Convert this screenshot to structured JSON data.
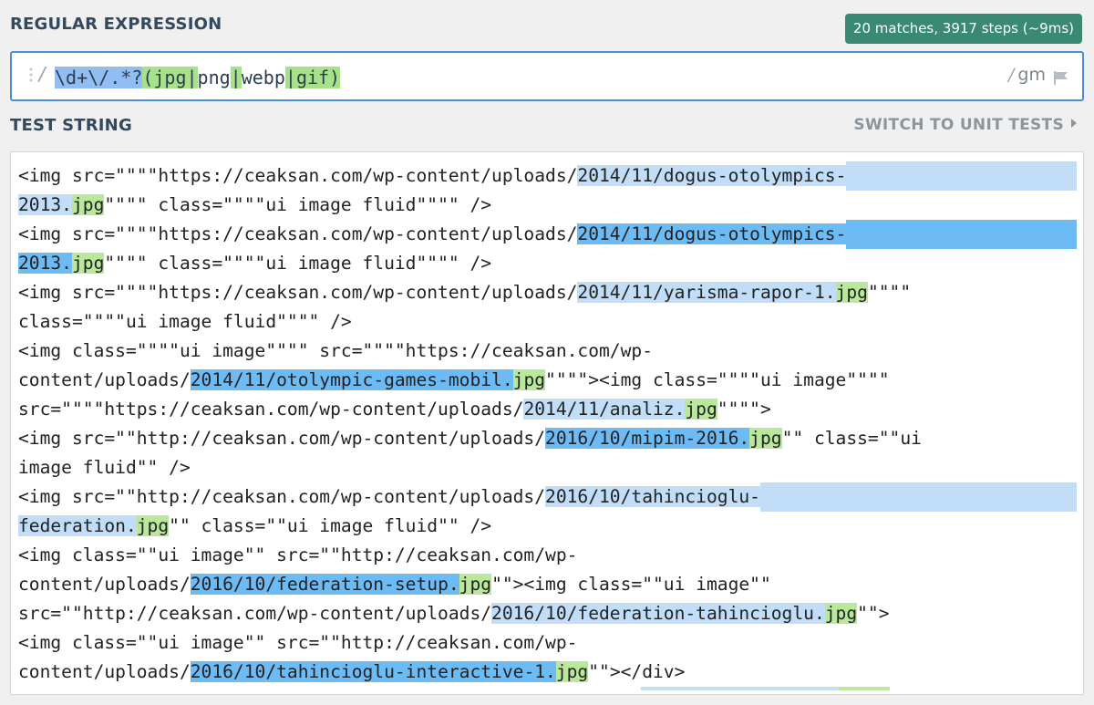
{
  "regex_section": {
    "label": "REGULAR EXPRESSION",
    "match_info": "20 matches, 3917 steps (~9ms)",
    "open_slash": "/",
    "close_slash": "/",
    "flags": "gm",
    "tokens": [
      {
        "text": "\\d+\\/.*?",
        "style": "blue"
      },
      {
        "text": "(jpg",
        "style": "green-paren"
      },
      {
        "text": "|",
        "style": "green"
      },
      {
        "text": "png",
        "style": "plain"
      },
      {
        "text": "|",
        "style": "green"
      },
      {
        "text": "webp",
        "style": "plain"
      },
      {
        "text": "|",
        "style": "green"
      },
      {
        "text": "gif)",
        "style": "green-paren"
      }
    ]
  },
  "test_section": {
    "label": "TEST STRING",
    "switch_label": "SWITCH TO UNIT TESTS",
    "lines": [
      [
        {
          "t": "<img src=\"\"\"\"https://ceaksan.com/wp-content/uploads/"
        },
        {
          "t": "2014/11/dogus-otolympics-",
          "c": "m-light"
        },
        {
          "t": "",
          "c": "m-light",
          "fill": true
        }
      ],
      [
        {
          "t": "2013.",
          "c": "m-light"
        },
        {
          "t": "jpg",
          "c": "g"
        },
        {
          "t": "\"\"\"\" class=\"\"\"\"ui image fluid\"\"\"\" />"
        }
      ],
      [
        {
          "t": "<img src=\"\"\"\"https://ceaksan.com/wp-content/uploads/"
        },
        {
          "t": "2014/11/dogus-otolympics-",
          "c": "m-dark"
        },
        {
          "t": "",
          "c": "m-dark",
          "fill": true
        }
      ],
      [
        {
          "t": "2013.",
          "c": "m-dark"
        },
        {
          "t": "jpg",
          "c": "g"
        },
        {
          "t": "\"\"\"\" class=\"\"\"\"ui image fluid\"\"\"\" />"
        }
      ],
      [
        {
          "t": "<img src=\"\"\"\"https://ceaksan.com/wp-content/uploads/"
        },
        {
          "t": "2014/11/yarisma-rapor-1.",
          "c": "m-light"
        },
        {
          "t": "jpg",
          "c": "g"
        },
        {
          "t": "\"\"\"\""
        }
      ],
      [
        {
          "t": "class=\"\"\"\"ui image fluid\"\"\"\" />"
        }
      ],
      [
        {
          "t": "<img class=\"\"\"\"ui image\"\"\"\" src=\"\"\"\"https://ceaksan.com/wp-"
        }
      ],
      [
        {
          "t": "content/uploads/"
        },
        {
          "t": "2014/11/otolympic-games-mobil.",
          "c": "m-dark"
        },
        {
          "t": "jpg",
          "c": "g"
        },
        {
          "t": "\"\"\"\"><img class=\"\"\"\"ui image\"\"\"\""
        }
      ],
      [
        {
          "t": "src=\"\"\"\"https://ceaksan.com/wp-content/uploads/"
        },
        {
          "t": "2014/11/analiz.",
          "c": "m-light"
        },
        {
          "t": "jpg",
          "c": "g"
        },
        {
          "t": "\"\"\"\">"
        }
      ],
      [
        {
          "t": "<img src=\"\"http://ceaksan.com/wp-content/uploads/"
        },
        {
          "t": "2016/10/mipim-2016.",
          "c": "m-dark"
        },
        {
          "t": "jpg",
          "c": "g"
        },
        {
          "t": "\"\" class=\"\"ui"
        }
      ],
      [
        {
          "t": "image fluid\"\" />"
        }
      ],
      [
        {
          "t": "<img src=\"\"http://ceaksan.com/wp-content/uploads/"
        },
        {
          "t": "2016/10/tahincioglu-",
          "c": "m-light"
        },
        {
          "t": "",
          "c": "m-light",
          "fill": true
        }
      ],
      [
        {
          "t": "federation.",
          "c": "m-light"
        },
        {
          "t": "jpg",
          "c": "g"
        },
        {
          "t": "\"\" class=\"\"ui image fluid\"\" />"
        }
      ],
      [
        {
          "t": "<img class=\"\"ui image\"\" src=\"\"http://ceaksan.com/wp-"
        }
      ],
      [
        {
          "t": "content/uploads/"
        },
        {
          "t": "2016/10/federation-setup.",
          "c": "m-dark"
        },
        {
          "t": "jpg",
          "c": "g"
        },
        {
          "t": "\"\"><img class=\"\"ui image\"\""
        }
      ],
      [
        {
          "t": "src=\"\"http://ceaksan.com/wp-content/uploads/"
        },
        {
          "t": "2016/10/federation-tahincioglu.",
          "c": "m-light"
        },
        {
          "t": "jpg",
          "c": "g"
        },
        {
          "t": "\"\">"
        }
      ],
      [
        {
          "t": "<img class=\"\"ui image\"\" src=\"\"http://ceaksan.com/wp-"
        }
      ],
      [
        {
          "t": "content/uploads/"
        },
        {
          "t": "2016/10/tahincioglu-interactive-1.",
          "c": "m-dark"
        },
        {
          "t": "jpg",
          "c": "g"
        },
        {
          "t": "\"\"></div>"
        }
      ]
    ]
  },
  "colors": {
    "match_badge": "#3a8a73",
    "regex_border": "#4a90d9",
    "match_light": "#c2ddf7",
    "match_dark": "#6dbbf5",
    "group_green": "#b9e79c"
  },
  "icons": [
    "drag-handle-icon",
    "flag-icon",
    "chevron-right-icon"
  ]
}
